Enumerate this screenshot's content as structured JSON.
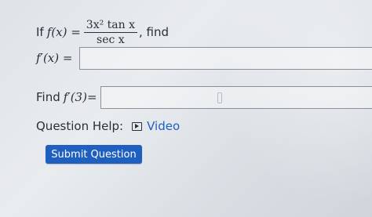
{
  "question": {
    "prefix": "If",
    "func_lhs": "f(x) =",
    "numerator": "3x² tan x",
    "denominator": "sec x",
    "suffix": ", find"
  },
  "derivative": {
    "label": "f′(x) =",
    "value": ""
  },
  "find": {
    "prefix": "Find",
    "label": "f′(3)=",
    "value": ""
  },
  "help": {
    "label": "Question Help:",
    "video_icon": "play-icon",
    "video_label": "Video"
  },
  "submit_label": "Submit Question",
  "colors": {
    "accent": "#1f5fbf",
    "text": "#2b2f36"
  }
}
